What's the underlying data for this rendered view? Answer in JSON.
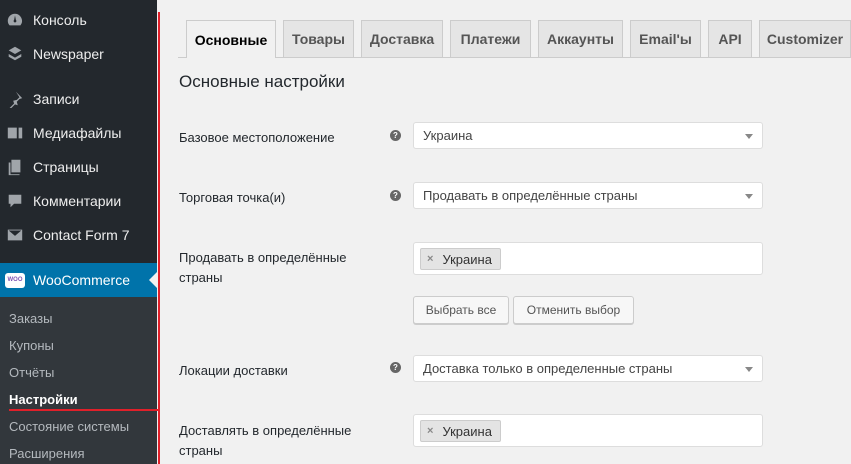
{
  "sidebar": {
    "items": [
      {
        "label": "Консоль",
        "icon": "dashboard-icon"
      },
      {
        "label": "Newspaper",
        "icon": "newspaper-icon"
      },
      {
        "label": "Записи",
        "icon": "pin-icon"
      },
      {
        "label": "Медиафайлы",
        "icon": "media-icon"
      },
      {
        "label": "Страницы",
        "icon": "pages-icon"
      },
      {
        "label": "Комментарии",
        "icon": "comments-icon"
      },
      {
        "label": "Contact Form 7",
        "icon": "mail-icon"
      },
      {
        "label": "WooCommerce",
        "icon": "woocommerce-icon",
        "badge": "WOO"
      }
    ],
    "submenu": [
      "Заказы",
      "Купоны",
      "Отчёты",
      "Настройки",
      "Состояние системы",
      "Расширения"
    ],
    "accent_color": "#0073aa",
    "highlight_color": "#e0202a"
  },
  "tabs": [
    "Основные",
    "Товары",
    "Доставка",
    "Платежи",
    "Аккаунты",
    "Email'ы",
    "API",
    "Customizer"
  ],
  "section_title": "Основные настройки",
  "fields": {
    "base_location": {
      "label": "Базовое местоположение",
      "value": "Украина"
    },
    "selling_location": {
      "label": "Торговая точка(и)",
      "value": "Продавать в определённые страны"
    },
    "specific_countries": {
      "label": "Продавать в определённые страны",
      "chip": "Украина",
      "select_all": "Выбрать все",
      "deselect": "Отменить выбор"
    },
    "shipping_locations": {
      "label": "Локации доставки",
      "value": "Доставка только в определенные страны"
    },
    "ship_countries": {
      "label": "Доставлять в определённые страны",
      "chip": "Украина"
    }
  },
  "help_glyph": "?",
  "remove_glyph": "×"
}
